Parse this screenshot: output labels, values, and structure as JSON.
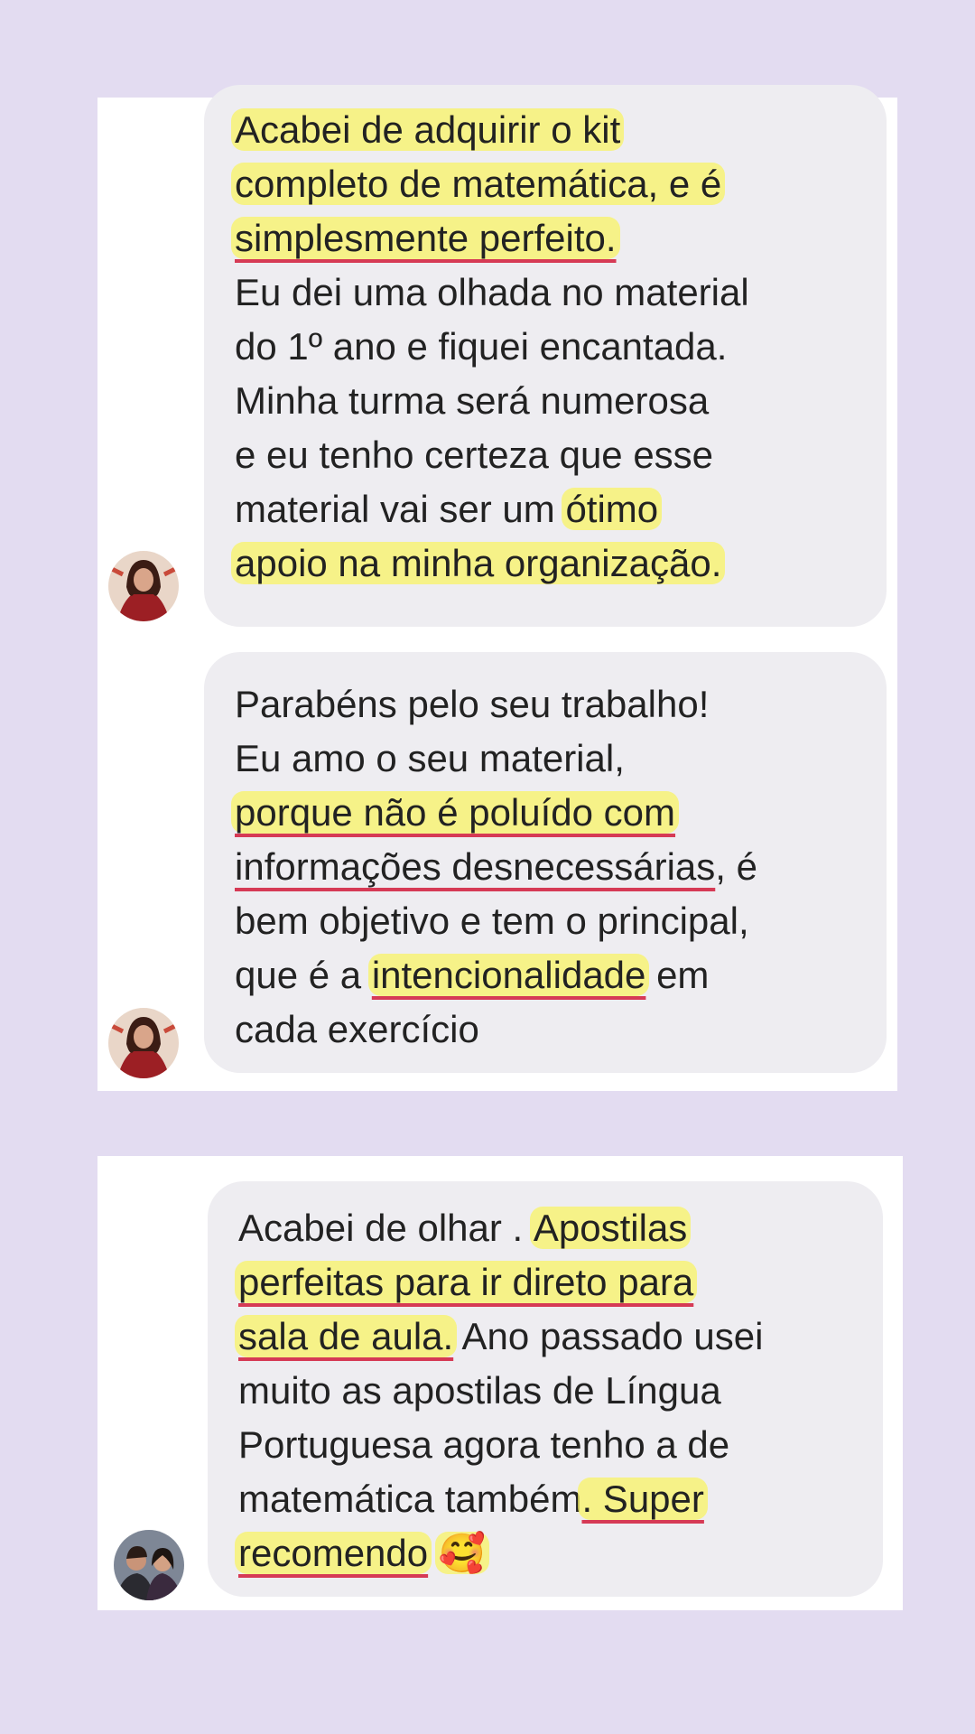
{
  "background_color": "#e3dcf1",
  "accent_colors": {
    "highlight": "#f9f45f",
    "underline": "#d63a55"
  },
  "comments": [
    {
      "avatar": "avatar-woman-red-icon",
      "lines": [
        "Acabei de adquirir o kit",
        "completo de matemática, e é",
        "simplesmente perfeito.",
        "Eu dei uma olhada no material",
        "do 1º ano e fiquei encantada.",
        "Minha turma será numerosa",
        "e eu tenho certeza que esse",
        {
          "before": "material vai ser um",
          "after": "ótimo"
        },
        "apoio na minha organização."
      ]
    },
    {
      "avatar": "avatar-woman-red-icon",
      "lines": [
        "Parabéns pelo seu trabalho!",
        "Eu amo o seu material,",
        "porque não é poluído com",
        {
          "before": "informações desnecessárias",
          "after": ", é"
        },
        "bem objetivo e tem o principal,",
        {
          "before": "que é a",
          "mid": "intencionalidade",
          "after": "em"
        },
        "cada exercício"
      ]
    },
    {
      "avatar": "avatar-couple-icon",
      "lines": [
        {
          "before": "Acabei de olhar .",
          "after": "Apostilas"
        },
        "perfeitas para ir direto para",
        {
          "before": "sala de aula.",
          "after": "Ano passado usei"
        },
        "muito as apostilas de Língua",
        "Portuguesa agora tenho a de",
        {
          "before": "matemática também",
          "after": ". Super"
        },
        {
          "before": "recomendo",
          "emoji": "🥰"
        }
      ]
    }
  ]
}
